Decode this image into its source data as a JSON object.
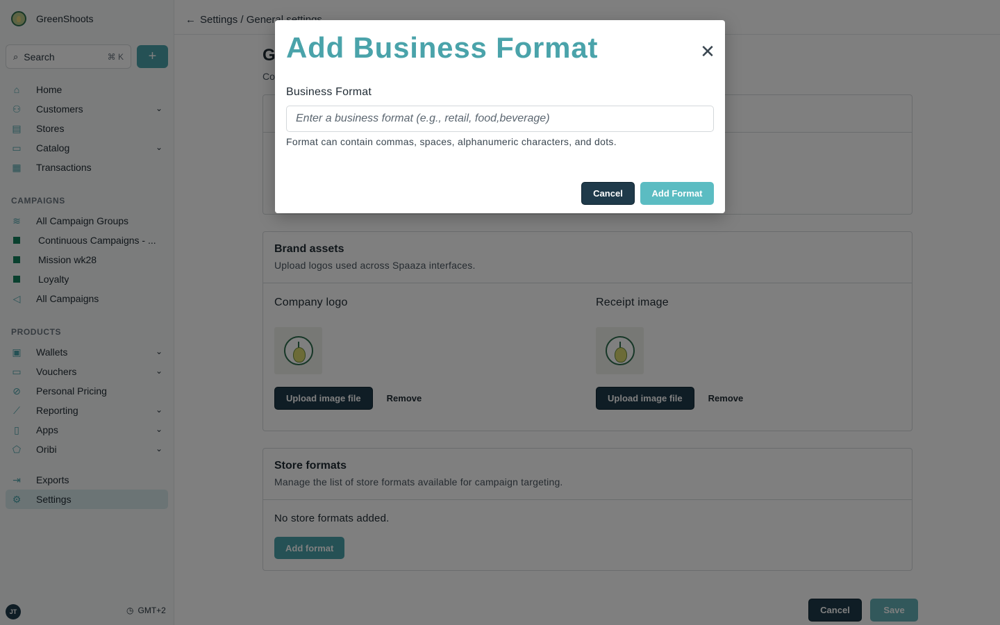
{
  "sidebar": {
    "brand": "GreenShoots",
    "search_label": "Search",
    "search_shortcut": "⌘ K",
    "add_button": "+",
    "main_items": [
      {
        "label": "Home",
        "icon": "home-icon",
        "glyph": "⌂",
        "chevron": false
      },
      {
        "label": "Customers",
        "icon": "users-icon",
        "glyph": "⚇",
        "chevron": true
      },
      {
        "label": "Stores",
        "icon": "store-icon",
        "glyph": "▤",
        "chevron": false
      },
      {
        "label": "Catalog",
        "icon": "catalog-icon",
        "glyph": "▭",
        "chevron": true
      },
      {
        "label": "Transactions",
        "icon": "receipt-icon",
        "glyph": "▦",
        "chevron": false
      }
    ],
    "campaigns_title": "CAMPAIGNS",
    "campaign_items": [
      {
        "label": "All Campaign Groups",
        "icon": "layers-icon",
        "glyph": "≋"
      },
      {
        "label": "Continuous Campaigns - ...",
        "icon": "square-icon",
        "glyph": ""
      },
      {
        "label": "Mission wk28",
        "icon": "square-icon",
        "glyph": ""
      },
      {
        "label": "Loyalty",
        "icon": "square-icon",
        "glyph": ""
      },
      {
        "label": "All Campaigns",
        "icon": "megaphone-icon",
        "glyph": "◁"
      }
    ],
    "products_title": "PRODUCTS",
    "product_items": [
      {
        "label": "Wallets",
        "icon": "wallet-icon",
        "glyph": "▣",
        "chevron": true
      },
      {
        "label": "Vouchers",
        "icon": "voucher-icon",
        "glyph": "▭",
        "chevron": true
      },
      {
        "label": "Personal Pricing",
        "icon": "percent-icon",
        "glyph": "⊘",
        "chevron": false
      },
      {
        "label": "Reporting",
        "icon": "chart-icon",
        "glyph": "⟋",
        "chevron": true
      },
      {
        "label": "Apps",
        "icon": "phone-icon",
        "glyph": "▯",
        "chevron": true
      },
      {
        "label": "Oribi",
        "icon": "tag-icon",
        "glyph": "⬠",
        "chevron": true
      }
    ],
    "bottom_items": [
      {
        "label": "Exports",
        "icon": "export-icon",
        "glyph": "⇥"
      },
      {
        "label": "Settings",
        "icon": "gear-icon",
        "glyph": "⚙"
      }
    ],
    "user_initials": "JT",
    "timezone": "GMT+2"
  },
  "header": {
    "breadcrumb": "Settings / General settings"
  },
  "page": {
    "title_initial": "G",
    "subtitle_initial": "Co"
  },
  "brand_assets": {
    "title": "Brand assets",
    "description": "Upload logos used across Spaaza interfaces.",
    "company_logo_label": "Company logo",
    "receipt_image_label": "Receipt image",
    "upload_label": "Upload image file",
    "remove_label": "Remove"
  },
  "store_formats": {
    "title": "Store formats",
    "description": "Manage the list of store formats available for campaign targeting.",
    "empty_text": "No store formats added.",
    "add_label": "Add format"
  },
  "footer": {
    "cancel": "Cancel",
    "save": "Save"
  },
  "modal": {
    "title": "Add Business Format",
    "field_label": "Business Format",
    "input_value": "",
    "input_placeholder": "Enter a business format (e.g., retail, food,beverage)",
    "help_text": "Format can contain commas, spaces, alphanumeric characters, and dots.",
    "cancel": "Cancel",
    "submit": "Add Format"
  },
  "colors": {
    "accent": "#4aa3aa",
    "dark_button": "#1f3a4a",
    "active_nav": "#d6e8ea"
  }
}
